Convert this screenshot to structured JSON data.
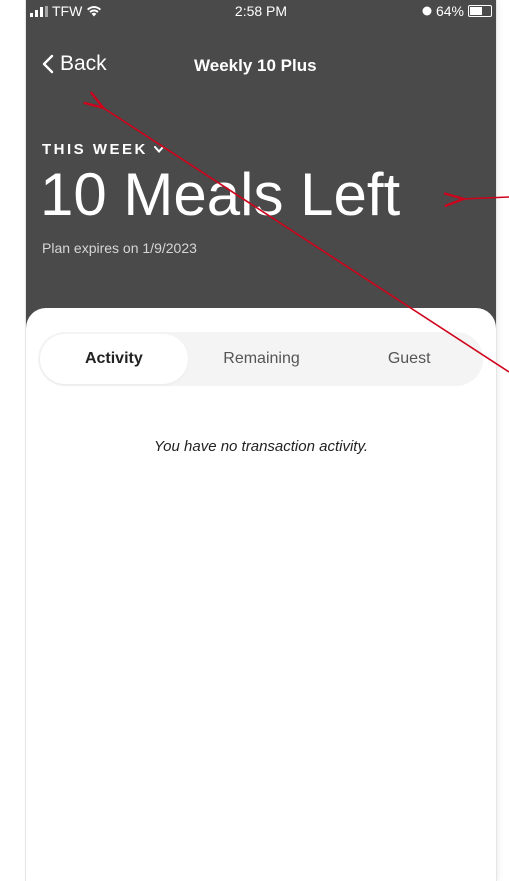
{
  "status_bar": {
    "carrier": "TFW",
    "time": "2:58 PM",
    "battery": "64%"
  },
  "nav": {
    "back_label": "Back",
    "title": "Weekly 10 Plus"
  },
  "plan": {
    "period_label": "THIS WEEK",
    "meals_left": "10 Meals Left",
    "expires": "Plan expires on 1/9/2023"
  },
  "tabs": [
    {
      "label": "Activity",
      "active": true
    },
    {
      "label": "Remaining",
      "active": false
    },
    {
      "label": "Guest",
      "active": false
    }
  ],
  "activity": {
    "empty_message": "You have no transaction activity."
  },
  "colors": {
    "header_bg": "#4a4a4a",
    "annotation_arrow": "#d0021b"
  }
}
